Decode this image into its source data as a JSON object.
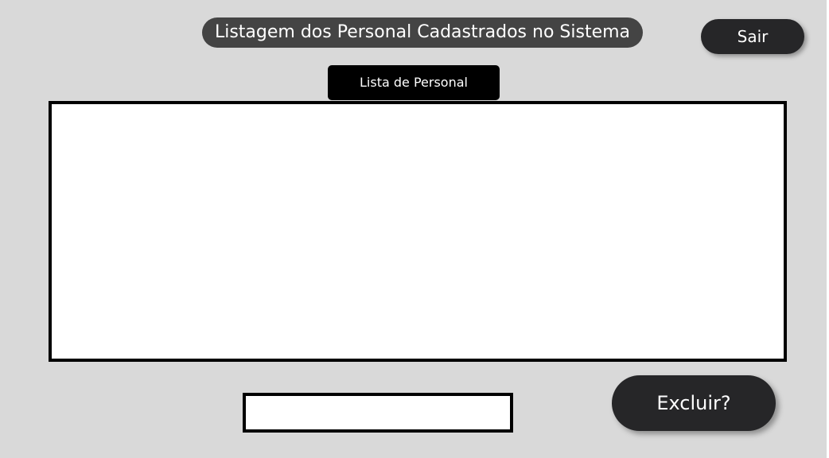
{
  "header": {
    "title": "Listagem dos Personal Cadastrados no Sistema",
    "logout_label": "Sair"
  },
  "list": {
    "label": "Lista de Personal",
    "items": []
  },
  "actions": {
    "id_input_value": "",
    "delete_label": "Excluir?"
  },
  "colors": {
    "background": "#d9d9d9",
    "title_pill": "#444444",
    "button": "#262628",
    "label_bg": "#000000"
  }
}
